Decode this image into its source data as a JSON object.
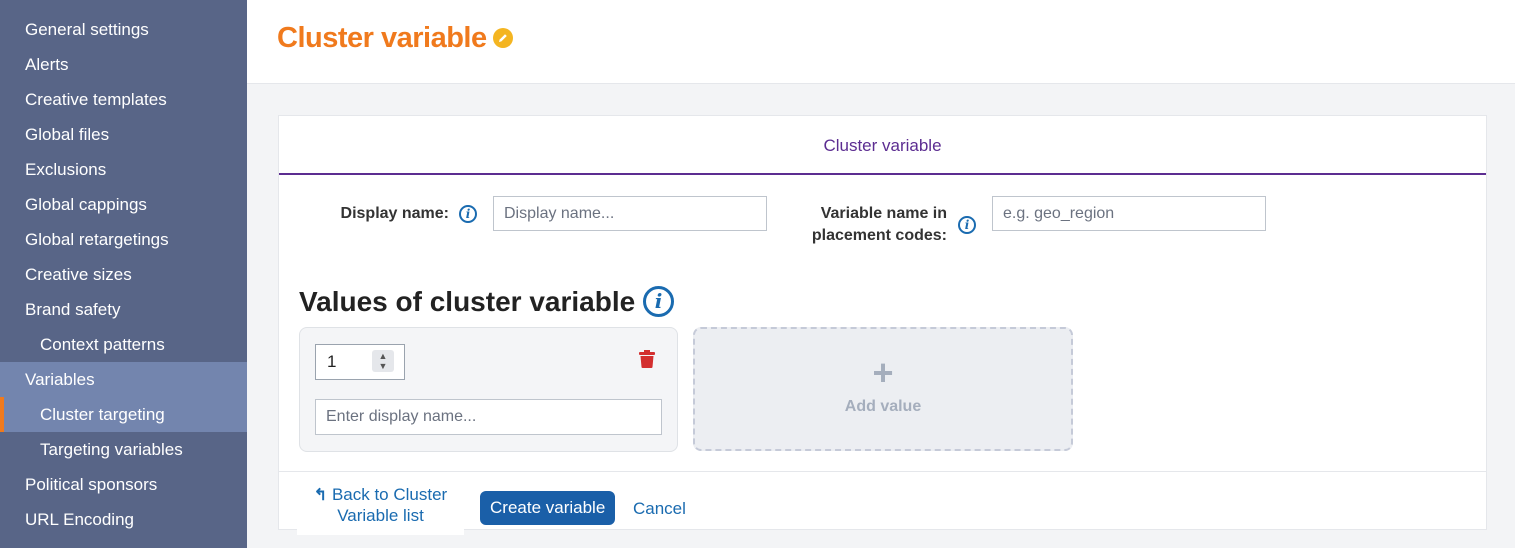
{
  "sidebar": {
    "items": [
      {
        "label": "General settings"
      },
      {
        "label": "Alerts"
      },
      {
        "label": "Creative templates"
      },
      {
        "label": "Global files"
      },
      {
        "label": "Exclusions"
      },
      {
        "label": "Global cappings"
      },
      {
        "label": "Global retargetings"
      },
      {
        "label": "Creative sizes"
      },
      {
        "label": "Brand safety"
      },
      {
        "label": "Context patterns"
      },
      {
        "label": "Variables"
      },
      {
        "label": "Cluster targeting"
      },
      {
        "label": "Targeting variables"
      },
      {
        "label": "Political sponsors"
      },
      {
        "label": "URL Encoding"
      }
    ]
  },
  "header": {
    "title": "Cluster variable",
    "edit_icon": "pencil-icon"
  },
  "panel": {
    "tab_label": "Cluster variable",
    "display_name": {
      "label": "Display name:",
      "placeholder": "Display name..."
    },
    "variable_name": {
      "label_line1": "Variable name in",
      "label_line2": "placement codes:",
      "placeholder": "e.g. geo_region"
    },
    "values_title": "Values of cluster variable",
    "value_card": {
      "number": "1",
      "name_placeholder": "Enter display name..."
    },
    "add_value_label": "Add value",
    "footer": {
      "back_line1": "Back to Cluster",
      "back_line2": "Variable list",
      "create_label": "Create variable",
      "cancel_label": "Cancel"
    }
  },
  "colors": {
    "sidebar": "#586587",
    "accent_orange": "#f07a1d",
    "tab_purple": "#5c2d91",
    "link_blue": "#1a6bb0",
    "primary_button": "#1a5fa8",
    "delete_red": "#d32f2f"
  }
}
